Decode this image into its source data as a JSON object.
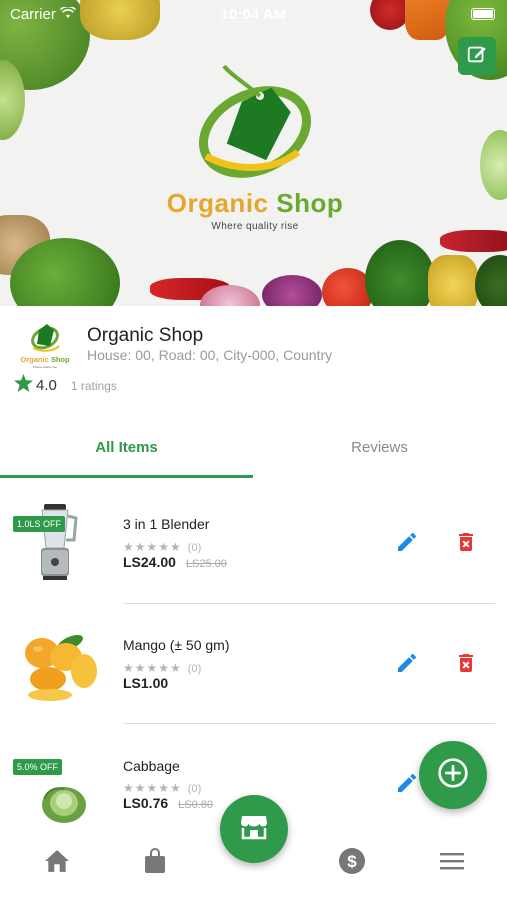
{
  "status_bar": {
    "carrier": "Carrier",
    "time": "10:04 AM"
  },
  "banner": {
    "logo_title_part1": "Organic",
    "logo_title_part2": "Shop",
    "tagline": "Where quality rise"
  },
  "shop": {
    "name": "Organic Shop",
    "address": "House: 00, Road: 00, City-000, Country",
    "rating": "4.0",
    "rating_count": "1 ratings",
    "logo_text": "Organic Shop"
  },
  "tabs": [
    {
      "label": "All Items",
      "active": true
    },
    {
      "label": "Reviews",
      "active": false
    }
  ],
  "products": [
    {
      "name": "3 in 1 Blender",
      "discount": "1.0LS OFF",
      "stars": "★★★★★",
      "review_count": "(0)",
      "price": "LS24.00",
      "old_price": "LS25.00"
    },
    {
      "name": "Mango (± 50 gm)",
      "discount": "",
      "stars": "★★★★★",
      "review_count": "(0)",
      "price": "LS1.00",
      "old_price": ""
    },
    {
      "name": "Cabbage",
      "discount": "5.0% OFF",
      "stars": "★★★★★",
      "review_count": "(0)",
      "price": "LS0.76",
      "old_price": "LS0.80"
    }
  ],
  "icons": {
    "edit_banner": "edit-square-icon",
    "edit": "pencil-icon",
    "delete": "trash-icon",
    "add": "plus-circle-icon",
    "nav": [
      "home-icon",
      "bag-icon",
      "store-icon",
      "dollar-icon",
      "menu-icon"
    ]
  },
  "colors": {
    "primary": "#2e9a4a",
    "delete": "#e53935",
    "edit": "#1e88e5",
    "logo_orange": "#e6a62e",
    "logo_green": "#6aa832"
  }
}
